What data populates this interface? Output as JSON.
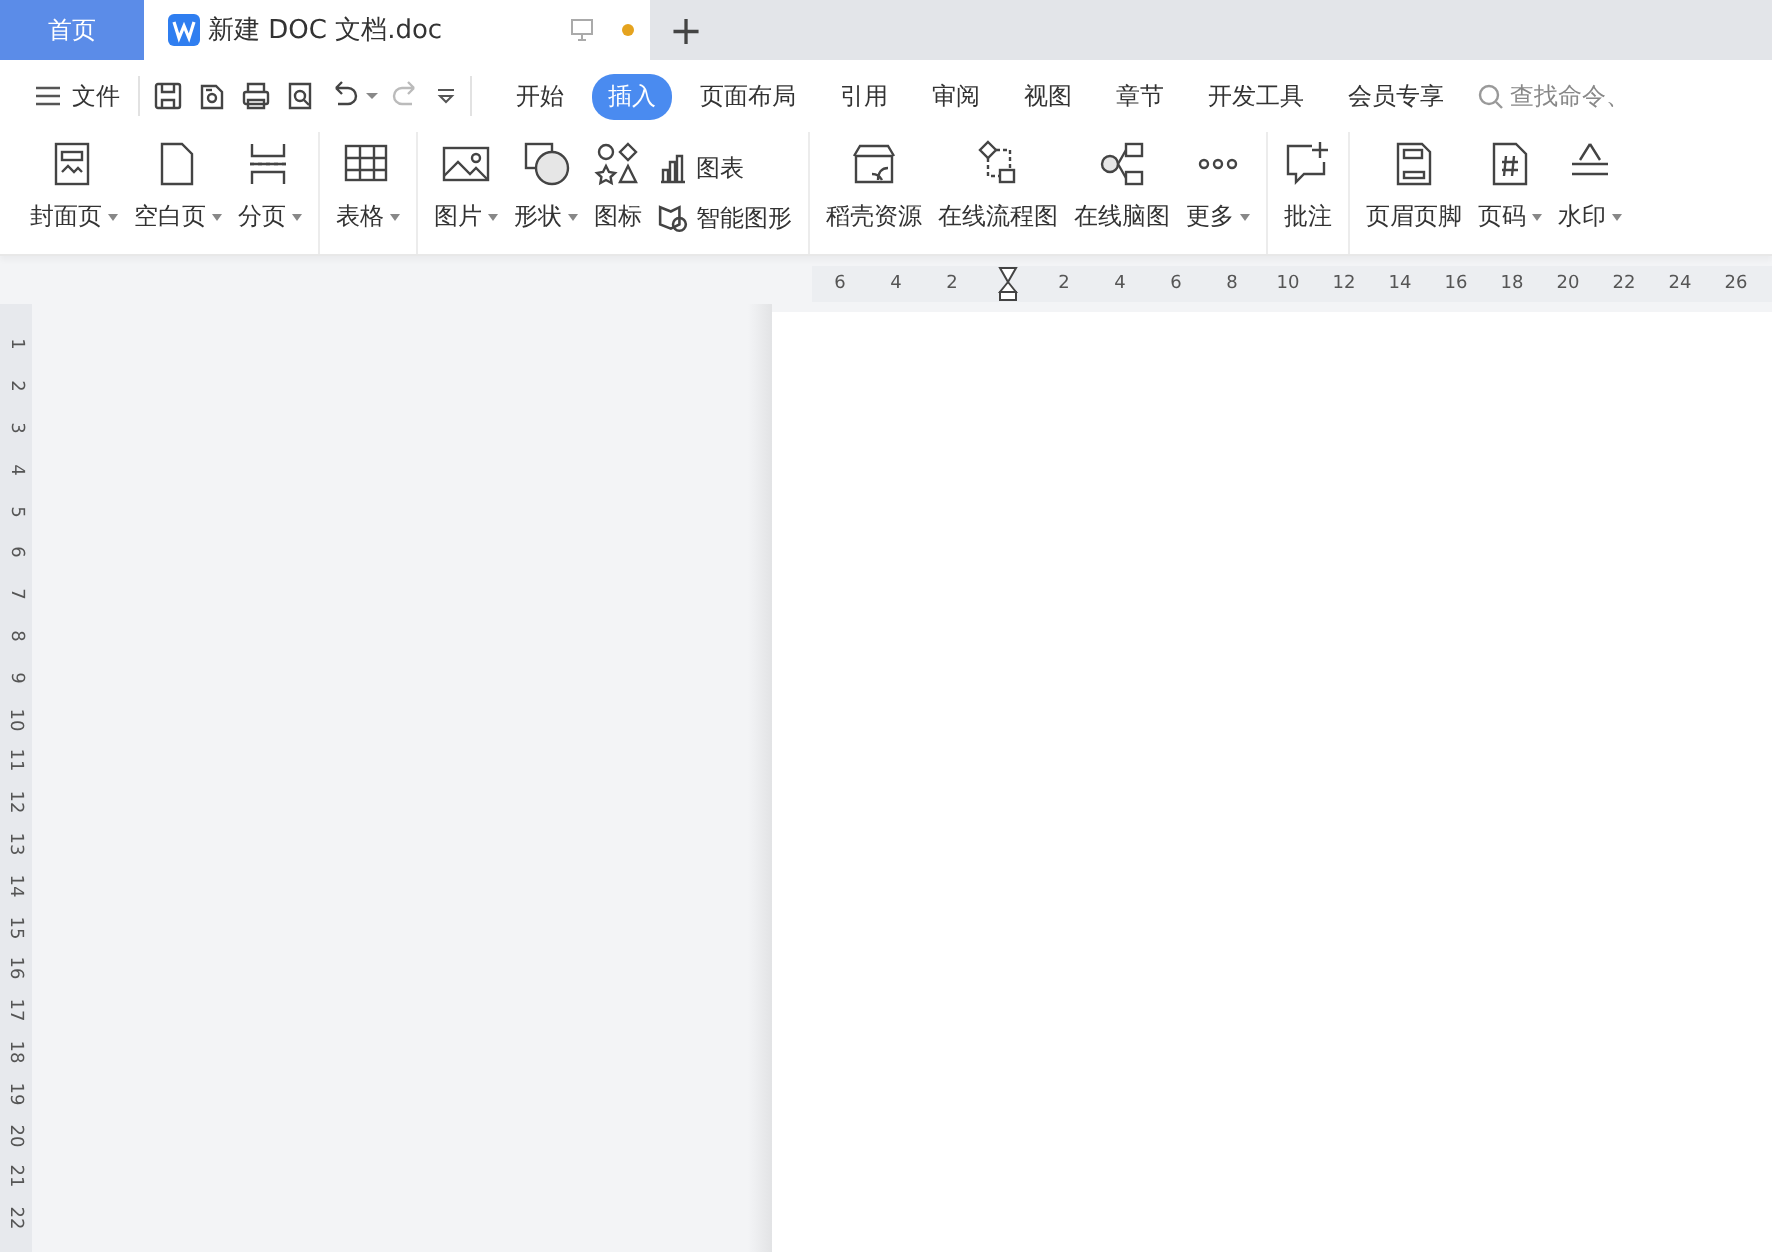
{
  "tabs": {
    "home": {
      "label": "首页",
      "selected": false
    },
    "document": {
      "label": "新建 DOC 文档.doc",
      "selected": true,
      "modified": true
    },
    "new_tab": "+"
  },
  "menu": {
    "file": "文件",
    "tabs": [
      {
        "label": "开始",
        "selected": false
      },
      {
        "label": "插入",
        "selected": true
      },
      {
        "label": "页面布局",
        "selected": false
      },
      {
        "label": "引用",
        "selected": false
      },
      {
        "label": "审阅",
        "selected": false
      },
      {
        "label": "视图",
        "selected": false
      },
      {
        "label": "章节",
        "selected": false
      },
      {
        "label": "开发工具",
        "selected": false
      },
      {
        "label": "会员专享",
        "selected": false
      }
    ],
    "search": {
      "placeholder": "查找命令、"
    }
  },
  "ribbon": {
    "groups": [
      [
        {
          "kind": "large",
          "label": "封面页",
          "dropdown": true
        },
        {
          "kind": "large",
          "label": "空白页",
          "dropdown": true
        },
        {
          "kind": "large",
          "label": "分页",
          "dropdown": true
        }
      ],
      [
        {
          "kind": "large",
          "label": "表格",
          "dropdown": true
        }
      ],
      [
        {
          "kind": "large",
          "label": "图片",
          "dropdown": true
        },
        {
          "kind": "large",
          "label": "形状",
          "dropdown": true
        },
        {
          "kind": "large",
          "label": "图标",
          "dropdown": false
        },
        {
          "kind": "small",
          "label": "图表",
          "dropdown": false
        },
        {
          "kind": "small",
          "label": "智能图形",
          "dropdown": false
        }
      ],
      [
        {
          "kind": "large",
          "label": "稻壳资源",
          "dropdown": false
        },
        {
          "kind": "large",
          "label": "在线流程图",
          "dropdown": false
        },
        {
          "kind": "large",
          "label": "在线脑图",
          "dropdown": false
        },
        {
          "kind": "large",
          "label": "更多",
          "dropdown": true
        }
      ],
      [
        {
          "kind": "large",
          "label": "批注",
          "dropdown": false
        }
      ],
      [
        {
          "kind": "large",
          "label": "页眉页脚",
          "dropdown": false
        },
        {
          "kind": "large",
          "label": "页码",
          "dropdown": true
        },
        {
          "kind": "large",
          "label": "水印",
          "dropdown": true
        }
      ]
    ]
  },
  "ruler": {
    "left_numbers": [
      "6",
      "4",
      "2"
    ],
    "right_numbers": [
      "2",
      "4",
      "6",
      "8",
      "10",
      "12",
      "14",
      "16",
      "18",
      "20",
      "22",
      "24",
      "26"
    ],
    "vertical_numbers": [
      "1",
      "2",
      "3",
      "4",
      "5",
      "6",
      "7",
      "8",
      "9",
      "10",
      "11",
      "12",
      "13",
      "14",
      "15",
      "16",
      "17",
      "18",
      "19",
      "20",
      "21",
      "22"
    ]
  }
}
